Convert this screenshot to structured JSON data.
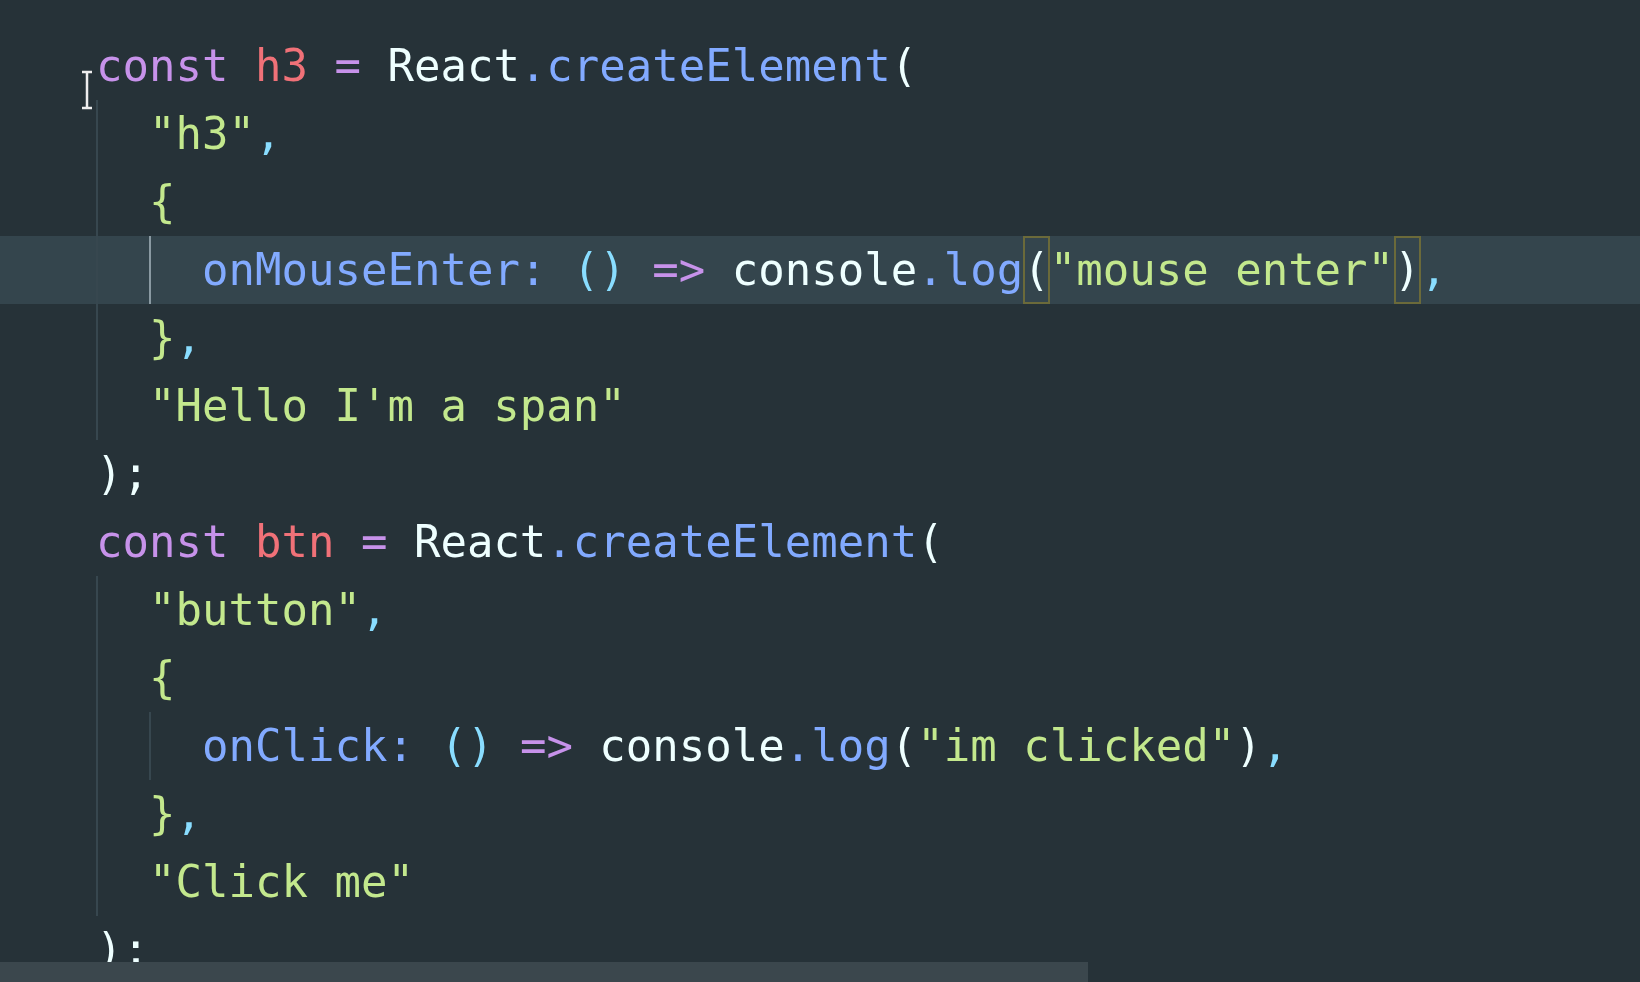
{
  "editor": {
    "lines": [
      {
        "current": false,
        "tokens": [
          {
            "kind": "keyword",
            "text": "const"
          },
          {
            "kind": "variable",
            "text": " h3"
          },
          {
            "kind": "operator",
            "text": " = "
          },
          {
            "kind": "plain",
            "text": "React"
          },
          {
            "kind": "method",
            "text": ".createElement"
          },
          {
            "kind": "plain",
            "text": "("
          }
        ],
        "children": [
          {
            "current": false,
            "tokens": [
              {
                "kind": "string",
                "text": "\"h3\""
              },
              {
                "kind": "punct",
                "text": ","
              }
            ]
          },
          {
            "current": false,
            "tokens": [
              {
                "kind": "brace",
                "text": "{"
              }
            ],
            "children": [
              {
                "current": true,
                "tokens": [
                  {
                    "kind": "property",
                    "text": "onMouseEnter:"
                  },
                  {
                    "kind": "punct",
                    "text": " () "
                  },
                  {
                    "kind": "operator",
                    "text": "=>"
                  },
                  {
                    "kind": "plain",
                    "text": " console"
                  },
                  {
                    "kind": "method",
                    "text": ".log"
                  },
                  {
                    "kind": "plain",
                    "text": "(",
                    "matched": true
                  },
                  {
                    "kind": "string",
                    "text": "\"mouse enter\""
                  },
                  {
                    "kind": "plain",
                    "text": ")",
                    "matched": true
                  },
                  {
                    "kind": "punct",
                    "text": ","
                  }
                ]
              }
            ]
          },
          {
            "current": false,
            "tokens": [
              {
                "kind": "brace",
                "text": "}"
              },
              {
                "kind": "punct",
                "text": ","
              }
            ]
          },
          {
            "current": false,
            "tokens": [
              {
                "kind": "string",
                "text": "\"Hello I'm a span\""
              }
            ]
          }
        ]
      },
      {
        "current": false,
        "tokens": [
          {
            "kind": "plain",
            "text": ");"
          }
        ]
      },
      {
        "current": false,
        "tokens": [
          {
            "kind": "keyword",
            "text": "const"
          },
          {
            "kind": "variable",
            "text": " btn"
          },
          {
            "kind": "operator",
            "text": " = "
          },
          {
            "kind": "plain",
            "text": "React"
          },
          {
            "kind": "method",
            "text": ".createElement"
          },
          {
            "kind": "plain",
            "text": "("
          }
        ],
        "children": [
          {
            "current": false,
            "tokens": [
              {
                "kind": "string",
                "text": "\"button\""
              },
              {
                "kind": "punct",
                "text": ","
              }
            ]
          },
          {
            "current": false,
            "tokens": [
              {
                "kind": "brace",
                "text": "{"
              }
            ],
            "children": [
              {
                "current": false,
                "tokens": [
                  {
                    "kind": "property",
                    "text": "onClick:"
                  },
                  {
                    "kind": "punct",
                    "text": " () "
                  },
                  {
                    "kind": "operator",
                    "text": "=>"
                  },
                  {
                    "kind": "plain",
                    "text": " console"
                  },
                  {
                    "kind": "method",
                    "text": ".log"
                  },
                  {
                    "kind": "plain",
                    "text": "("
                  },
                  {
                    "kind": "string",
                    "text": "\"im clicked\""
                  },
                  {
                    "kind": "plain",
                    "text": ")"
                  },
                  {
                    "kind": "punct",
                    "text": ","
                  }
                ]
              }
            ]
          },
          {
            "current": false,
            "tokens": [
              {
                "kind": "brace",
                "text": "}"
              },
              {
                "kind": "punct",
                "text": ","
              }
            ]
          },
          {
            "current": false,
            "tokens": [
              {
                "kind": "string",
                "text": "\"Click me\""
              }
            ]
          }
        ]
      },
      {
        "current": false,
        "tokens": [
          {
            "kind": "plain",
            "text": ");"
          }
        ]
      }
    ]
  }
}
